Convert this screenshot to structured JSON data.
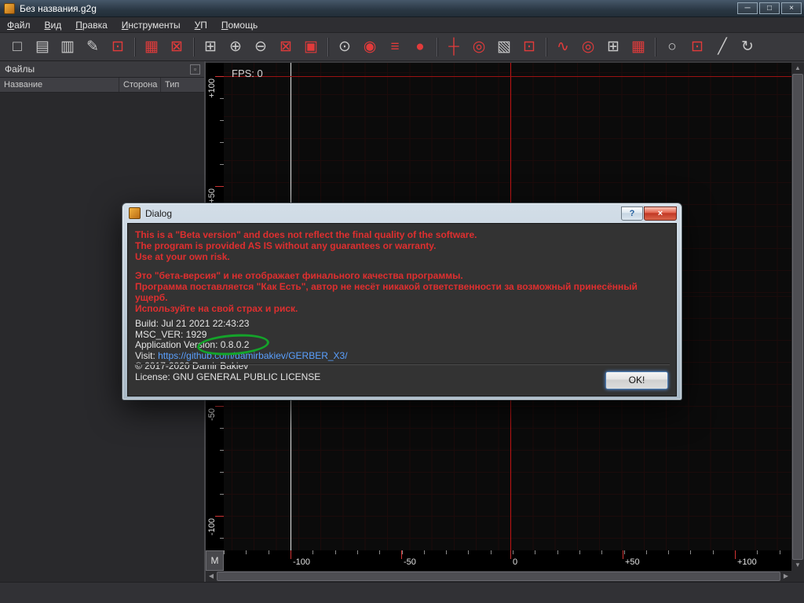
{
  "window": {
    "title": "Без названия.g2g",
    "buttons": {
      "minimize": "─",
      "maximize": "□",
      "close": "×"
    }
  },
  "menu": {
    "items": [
      {
        "id": "file",
        "label": "Файл"
      },
      {
        "id": "view",
        "label": "Вид"
      },
      {
        "id": "edit",
        "label": "Правка"
      },
      {
        "id": "tools",
        "label": "Инструменты"
      },
      {
        "id": "nc-program",
        "label": "УП"
      },
      {
        "id": "help",
        "label": "Помощь"
      }
    ]
  },
  "toolbar": {
    "items": [
      {
        "name": "new-file",
        "glyph": "□",
        "color": "grey"
      },
      {
        "name": "open-file",
        "glyph": "▤",
        "color": "grey"
      },
      {
        "name": "save",
        "glyph": "▥",
        "color": "grey"
      },
      {
        "name": "save-as",
        "glyph": "✎",
        "color": "grey"
      },
      {
        "name": "close-file",
        "glyph": "⊡",
        "color": "red"
      },
      {
        "sep": true
      },
      {
        "name": "print",
        "glyph": "▦",
        "color": "red"
      },
      {
        "name": "export",
        "glyph": "⊠",
        "color": "red"
      },
      {
        "sep": true
      },
      {
        "name": "zoom-fit",
        "glyph": "⊞",
        "color": "grey"
      },
      {
        "name": "zoom-in",
        "glyph": "⊕",
        "color": "grey"
      },
      {
        "name": "zoom-out",
        "glyph": "⊖",
        "color": "grey"
      },
      {
        "name": "zoom-100",
        "glyph": "⊠",
        "color": "red"
      },
      {
        "name": "zoom-selected",
        "glyph": "▣",
        "color": "red"
      },
      {
        "sep": true
      },
      {
        "name": "snap",
        "glyph": "⊙",
        "color": "grey"
      },
      {
        "name": "run",
        "glyph": "◉",
        "color": "red"
      },
      {
        "name": "report",
        "glyph": "≡",
        "color": "red"
      },
      {
        "name": "thermal",
        "glyph": "●",
        "color": "red"
      },
      {
        "sep": true
      },
      {
        "name": "crosshair",
        "glyph": "┼",
        "color": "red"
      },
      {
        "name": "drill",
        "glyph": "◎",
        "color": "red"
      },
      {
        "name": "board",
        "glyph": "▧",
        "color": "grey"
      },
      {
        "name": "pocket",
        "glyph": "⊡",
        "color": "red"
      },
      {
        "sep": true
      },
      {
        "name": "profile",
        "glyph": "∿",
        "color": "red"
      },
      {
        "name": "voronoi",
        "glyph": "◎",
        "color": "red"
      },
      {
        "name": "grid",
        "glyph": "⊞",
        "color": "grey"
      },
      {
        "name": "matrix",
        "glyph": "▦",
        "color": "red"
      },
      {
        "sep": true
      },
      {
        "name": "circle-tool",
        "glyph": "○",
        "color": "grey"
      },
      {
        "name": "rect-tool",
        "glyph": "⊡",
        "color": "red"
      },
      {
        "name": "line-tool",
        "glyph": "╱",
        "color": "grey"
      },
      {
        "name": "rotate",
        "glyph": "↻",
        "color": "grey"
      }
    ]
  },
  "sidebar": {
    "title": "Файлы",
    "float_glyph": "▫",
    "columns": [
      "Название",
      "Сторона",
      "Тип"
    ]
  },
  "canvas": {
    "fps": "FPS: 0"
  },
  "rulers": {
    "corner": "M",
    "bottom": {
      "minor_step": 28.3,
      "majors": [
        {
          "text": "-100",
          "pos": 85
        },
        {
          "text": "-50",
          "pos": 226
        },
        {
          "text": "0",
          "pos": 365
        },
        {
          "text": "+50",
          "pos": 508
        },
        {
          "text": "+100",
          "pos": 651
        }
      ]
    },
    "left": {
      "minor_step": 28,
      "majors": [
        {
          "text": "+100",
          "pos": 17
        },
        {
          "text": "+50",
          "pos": 157
        },
        {
          "text": "-50",
          "pos": 437
        },
        {
          "text": "-100",
          "pos": 577
        }
      ]
    }
  },
  "scrollbars": {
    "up": "▲",
    "down": "▼",
    "left": "◀",
    "right": "▶"
  },
  "dialog": {
    "title": "Dialog",
    "buttons": {
      "help": "?",
      "close": "×"
    },
    "warning_en": [
      "This is a \"Beta version\" and does not reflect the final quality of the software.",
      "The program is provided AS IS without any guarantees or warranty.",
      "Use at your own risk."
    ],
    "warning_ru": [
      "Это \"бета-версия\" и не отображает финального качества программы.",
      "Программа поставляется \"Как Есть\", автор не несёт никакой ответственности за возможный принесённый ущерб.",
      "Используйте на свой страх и риск."
    ],
    "build": "Build: Jul 21 2021 22:43:23",
    "msc_ver": "MSC_VER: 1929",
    "app_version_label": "Application Version: ",
    "app_version": "0.8.0.2",
    "visit_label": "Visit: ",
    "visit_url": "https://github.com/damirbakiev/GERBER_X3/",
    "copyright": "© 2017-2020 Damir Bakiev",
    "license": "License: GNU GENERAL PUBLIC LICENSE",
    "ok_label": "OK!"
  },
  "colors": {
    "accent_red": "#e23b3b",
    "grid_minor": "#1c0b0b",
    "grid_major": "#4d1111",
    "axis_red": "#c21414",
    "axis_white": "#e6e6e6",
    "warning_red": "#df2f2f",
    "link_blue": "#5aa0ff",
    "annotation_green": "#14a32a"
  }
}
